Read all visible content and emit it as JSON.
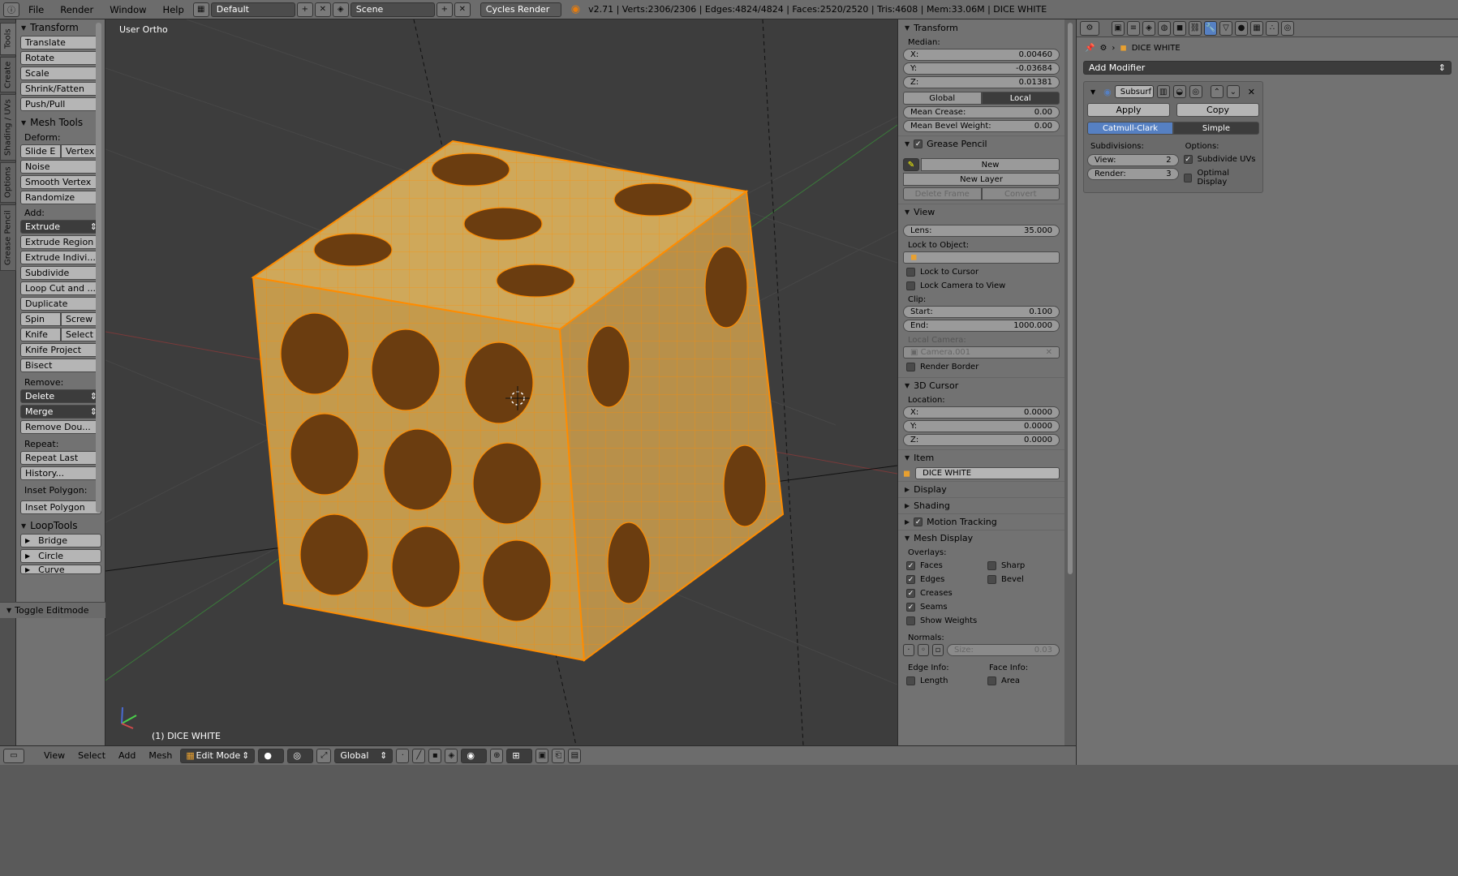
{
  "topbar": {
    "menus": [
      "File",
      "Render",
      "Window",
      "Help"
    ],
    "layout": "Default",
    "scene": "Scene",
    "engine": "Cycles Render",
    "info": "v2.71 | Verts:2306/2306 | Edges:4824/4824 | Faces:2520/2520 | Tris:4608 | Mem:33.06M | DICE WHITE"
  },
  "left_tabs": [
    "Tools",
    "Create",
    "Shading / UVs",
    "Options",
    "Grease Pencil"
  ],
  "toolshelf": {
    "transform": {
      "title": "Transform",
      "buttons": [
        "Translate",
        "Rotate",
        "Scale",
        "Shrink/Fatten",
        "Push/Pull"
      ]
    },
    "mesh_tools": {
      "title": "Mesh Tools",
      "deform_label": "Deform:",
      "slide_edge": "Slide E",
      "vertex": "Vertex",
      "noise": "Noise",
      "smooth_vertex": "Smooth Vertex",
      "randomize": "Randomize",
      "add_label": "Add:",
      "extrude": "Extrude",
      "extrude_region": "Extrude Region",
      "extrude_individual": "Extrude Indivi...",
      "subdivide": "Subdivide",
      "loop_cut": "Loop Cut and ...",
      "duplicate": "Duplicate",
      "spin": "Spin",
      "screw": "Screw",
      "knife": "Knife",
      "select": "Select",
      "knife_project": "Knife Project",
      "bisect": "Bisect",
      "remove_label": "Remove:",
      "delete": "Delete",
      "merge": "Merge",
      "remove_doubles": "Remove Dou...",
      "repeat_label": "Repeat:",
      "repeat_last": "Repeat Last",
      "history": "History...",
      "inset_label": "Inset Polygon:",
      "inset_polygon": "Inset Polygon"
    },
    "looptools": {
      "title": "LoopTools",
      "items": [
        "Bridge",
        "Circle",
        "Curve"
      ]
    },
    "toggle_editmode": "Toggle Editmode"
  },
  "viewport": {
    "view_label": "User Ortho",
    "object_label": "(1) DICE WHITE",
    "accent_wire": "#ff8c00",
    "face_fill": "#c9a050",
    "pip_fill": "#6b3d10"
  },
  "npanel": {
    "transform": {
      "title": "Transform",
      "median_label": "Median:",
      "x_label": "X:",
      "x": "0.00460",
      "y_label": "Y:",
      "y": "-0.03684",
      "z_label": "Z:",
      "z": "0.01381",
      "global": "Global",
      "local": "Local",
      "mean_crease_label": "Mean Crease:",
      "mean_crease": "0.00",
      "mean_bevel_label": "Mean Bevel Weight:",
      "mean_bevel": "0.00"
    },
    "grease_pencil": {
      "title": "Grease Pencil",
      "new": "New",
      "new_layer": "New Layer",
      "delete_frame": "Delete Frame",
      "convert": "Convert"
    },
    "view": {
      "title": "View",
      "lens_label": "Lens:",
      "lens": "35.000",
      "lock_object_label": "Lock to Object:",
      "lock_cursor": "Lock to Cursor",
      "lock_camera": "Lock Camera to View",
      "clip_label": "Clip:",
      "start_label": "Start:",
      "start": "0.100",
      "end_label": "End:",
      "end": "1000.000",
      "local_camera_label": "Local Camera:",
      "local_camera": "Camera.001",
      "render_border": "Render Border"
    },
    "cursor": {
      "title": "3D Cursor",
      "location_label": "Location:",
      "x_label": "X:",
      "x": "0.0000",
      "y_label": "Y:",
      "y": "0.0000",
      "z_label": "Z:",
      "z": "0.0000"
    },
    "item": {
      "title": "Item",
      "name": "DICE WHITE"
    },
    "display": "Display",
    "shading": "Shading",
    "motion_tracking": "Motion Tracking",
    "mesh_display": {
      "title": "Mesh Display",
      "overlays_label": "Overlays:",
      "faces": "Faces",
      "sharp": "Sharp",
      "edges": "Edges",
      "bevel": "Bevel",
      "creases": "Creases",
      "seams": "Seams",
      "show_weights": "Show Weights",
      "normals_label": "Normals:",
      "size_label": "Size:",
      "size": "0.03",
      "edge_info_label": "Edge Info:",
      "face_info_label": "Face Info:",
      "length": "Length",
      "area": "Area"
    }
  },
  "properties": {
    "object_name": "DICE WHITE",
    "add_modifier": "Add Modifier",
    "modifier_name": "Subsurf",
    "apply": "Apply",
    "copy": "Copy",
    "catmull_clark": "Catmull-Clark",
    "simple": "Simple",
    "subdivisions_label": "Subdivisions:",
    "options_label": "Options:",
    "view_label": "View:",
    "view_value": "2",
    "render_label": "Render:",
    "render_value": "3",
    "subdivide_uvs": "Subdivide UVs",
    "optimal_display": "Optimal Display",
    "accent": "#5680c2"
  },
  "statusbar": {
    "menus": [
      "View",
      "Select",
      "Add",
      "Mesh"
    ],
    "mode": "Edit Mode",
    "orientation": "Global"
  }
}
